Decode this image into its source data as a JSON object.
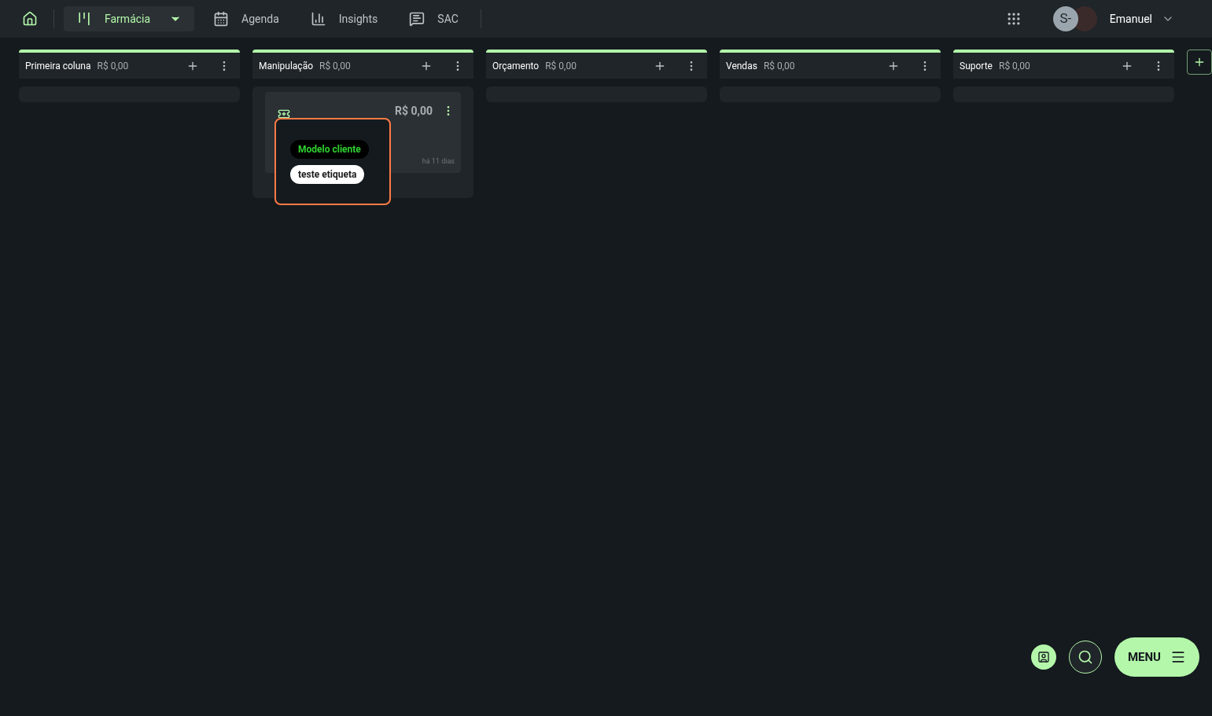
{
  "nav": {
    "items": [
      {
        "kind": "board",
        "label": "Farmácia",
        "selected": true
      },
      {
        "kind": "calendar",
        "label": "Agenda",
        "selected": false
      },
      {
        "kind": "chart",
        "label": "Insights",
        "selected": false
      },
      {
        "kind": "chat",
        "label": "SAC",
        "selected": false
      }
    ],
    "user": {
      "initials": "S-",
      "name": "Emanuel"
    }
  },
  "columns": [
    {
      "title": "Primeira coluna",
      "total": "R$ 0,00"
    },
    {
      "title": "Manipulação",
      "total": "R$ 0,00",
      "cards": [
        {
          "value": "R$ 0,00",
          "age": "há 11 dias",
          "tags_popup": [
            {
              "kind": "dark",
              "label": "Modelo cliente"
            },
            {
              "kind": "light",
              "label": "teste etiqueta"
            }
          ]
        }
      ]
    },
    {
      "title": "Orçamento",
      "total": "R$ 0,00"
    },
    {
      "title": "Vendas",
      "total": "R$ 0,00"
    },
    {
      "title": "Suporte",
      "total": "R$ 0,00"
    }
  ],
  "fab": {
    "menu_label": "MENU"
  }
}
